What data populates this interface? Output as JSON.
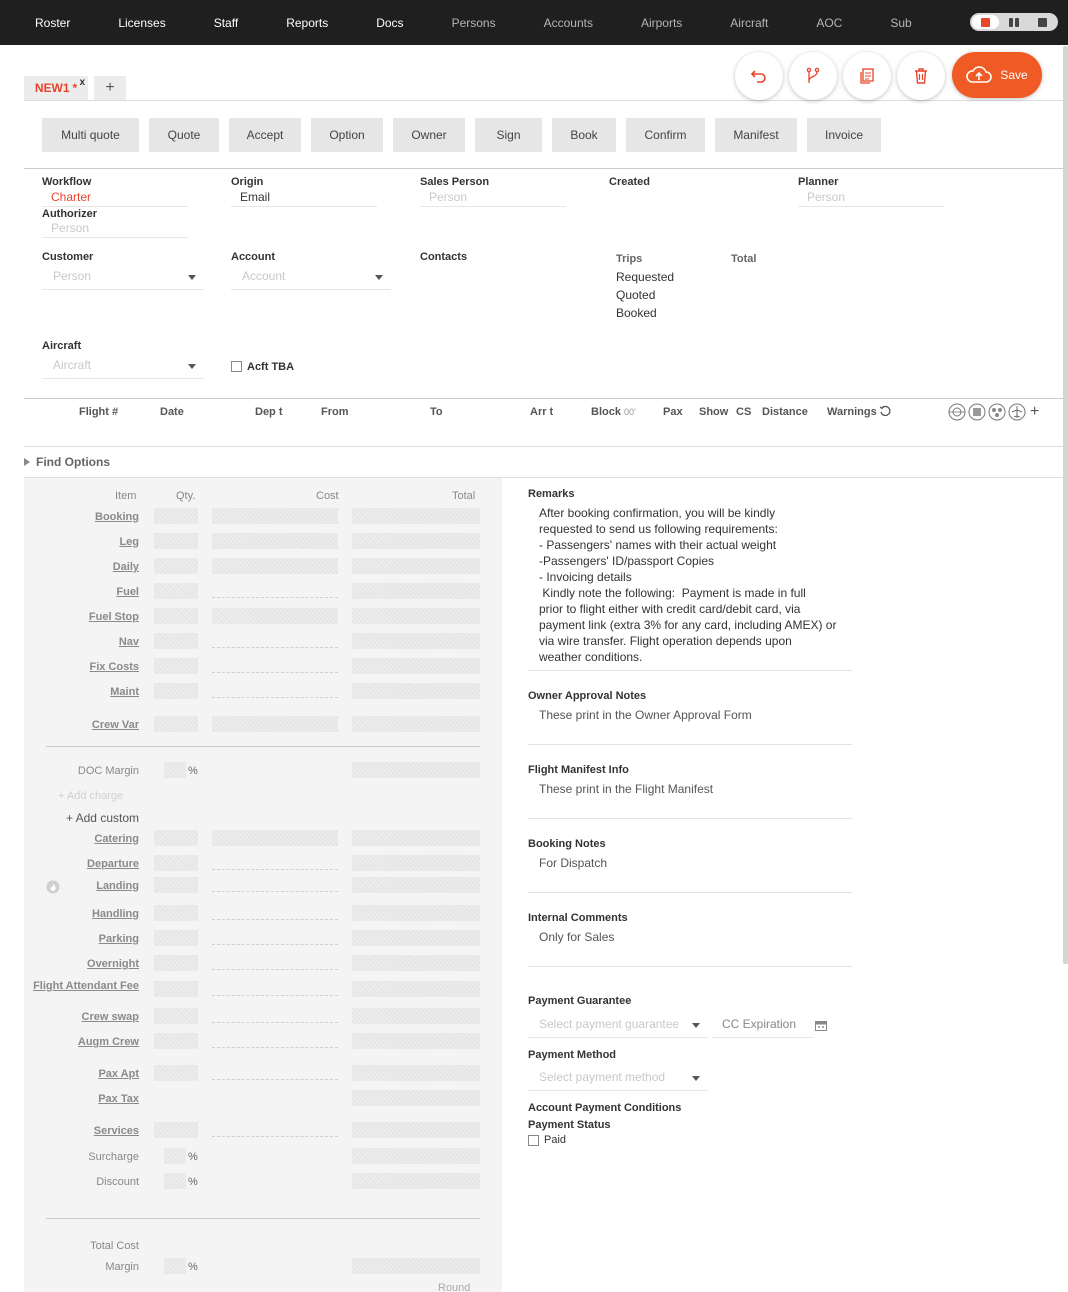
{
  "nav": {
    "items": [
      "Roster",
      "Licenses",
      "Staff",
      "Reports",
      "Docs",
      "Persons",
      "Accounts",
      "Airports",
      "Aircraft",
      "AOC",
      "Sub"
    ]
  },
  "tabs": {
    "active_label": "NEW1",
    "active_marker": "*",
    "close": "x",
    "add": "+"
  },
  "actions": {
    "save_label": "Save"
  },
  "workflow_buttons": [
    "Multi quote",
    "Quote",
    "Accept",
    "Option",
    "Owner",
    "Sign",
    "Book",
    "Confirm",
    "Manifest",
    "Invoice"
  ],
  "header": {
    "workflow_label": "Workflow",
    "workflow_value": "Charter",
    "authorizer_label": "Authorizer",
    "authorizer_placeholder": "Person",
    "origin_label": "Origin",
    "origin_value": "Email",
    "sales_person_label": "Sales Person",
    "sales_person_placeholder": "Person",
    "created_label": "Created",
    "planner_label": "Planner",
    "planner_placeholder": "Person",
    "customer_label": "Customer",
    "customer_placeholder": "Person",
    "account_label": "Account",
    "account_placeholder": "Account",
    "contacts_label": "Contacts",
    "trips_label": "Trips",
    "total_label": "Total",
    "trips_rows": [
      "Requested",
      "Quoted",
      "Booked"
    ],
    "aircraft_label": "Aircraft",
    "aircraft_placeholder": "Aircraft",
    "acft_tba_label": "Acft TBA"
  },
  "flight_table": {
    "columns": [
      "Flight #",
      "Date",
      "Dep t",
      "From",
      "To",
      "Arr t",
      "Block",
      "Pax",
      "Show",
      "CS",
      "Distance",
      "Warnings"
    ],
    "block_suffix": "00'"
  },
  "find_options": "Find Options",
  "pricing": {
    "col_item": "Item",
    "col_qty": "Qty.",
    "col_cost": "Cost",
    "col_total": "Total",
    "rows1": [
      "Booking",
      "Leg",
      "Daily",
      "Fuel",
      "Fuel Stop",
      "Nav",
      "Fix Costs",
      "Maint",
      "Crew Var"
    ],
    "doc_margin": "DOC Margin",
    "pct": "%",
    "add_charge": "+ Add charge",
    "add_custom": "+ Add custom",
    "rows2": [
      "Catering",
      "Departure",
      "Landing",
      "Handling",
      "Parking",
      "Overnight",
      "Flight Attendant Fee",
      "Crew swap",
      "Augm Crew",
      "Pax Apt",
      "Pax Tax",
      "Services"
    ],
    "surcharge": "Surcharge",
    "discount": "Discount",
    "total_cost": "Total Cost",
    "margin": "Margin",
    "round": "Round"
  },
  "remarks": {
    "label": "Remarks",
    "text": "After booking confirmation, you will be kindly\nrequested to send us following requirements:\n- Passengers' names with their actual weight\n-Passengers' ID/passport Copies\n- Invoicing details\n Kindly note the following:  Payment is made in full\nprior to flight either with credit card/debit card, via\npayment link (extra 3% for any card, including AMEX) or\nvia wire transfer. Flight operation depends upon\nweather conditions."
  },
  "notes": {
    "owner_label": "Owner Approval Notes",
    "owner_text": "These print in the Owner Approval Form",
    "manifest_label": "Flight Manifest Info",
    "manifest_text": "These print in the Flight Manifest",
    "booking_label": "Booking Notes",
    "booking_text": "For Dispatch",
    "internal_label": "Internal Comments",
    "internal_text": "Only for Sales"
  },
  "payment": {
    "guarantee_label": "Payment Guarantee",
    "guarantee_placeholder": "Select payment guarantee",
    "cc_expiration": "CC Expiration",
    "method_label": "Payment Method",
    "method_placeholder": "Select payment method",
    "conditions_label": "Account Payment Conditions",
    "status_label": "Payment Status",
    "paid_label": "Paid"
  },
  "colors": {
    "accent": "#f05a24",
    "nav_bg": "#1f1f1f",
    "workflow_value": "#e8442a"
  }
}
